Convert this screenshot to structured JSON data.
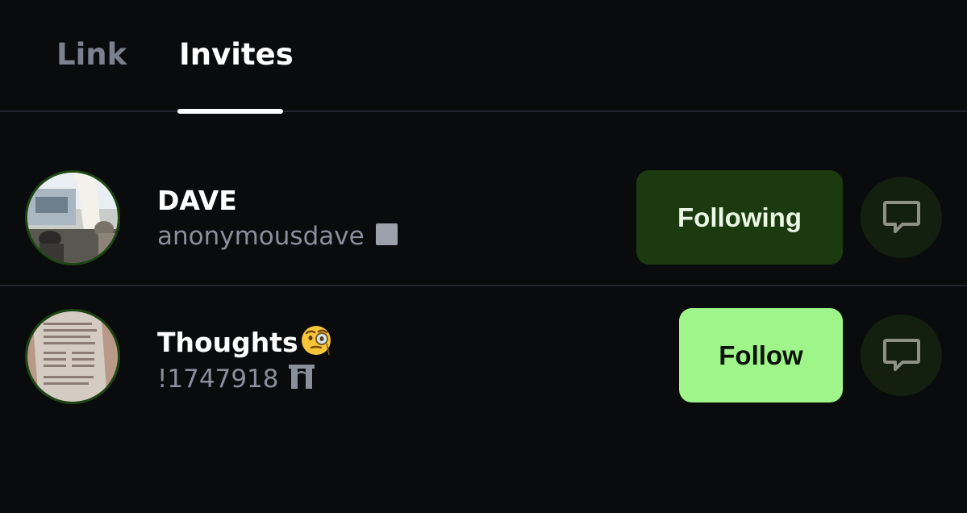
{
  "tabs": [
    {
      "label": "Link",
      "active": false
    },
    {
      "label": "Invites",
      "active": true
    }
  ],
  "users": [
    {
      "name": "DAVE",
      "handle": "anonymousdave",
      "badge_icon": "square-badge-icon",
      "action_label": "Following",
      "action_state": "following",
      "avatar_icon": "room-photo-avatar",
      "message_icon": "chat-bubble-icon"
    },
    {
      "name": "Thoughts",
      "name_emoji": "face-with-monocle",
      "handle": "!1747918",
      "badge_icon": "gate-icon",
      "action_label": "Follow",
      "action_state": "not-following",
      "avatar_icon": "book-page-avatar",
      "message_icon": "chat-bubble-icon"
    }
  ],
  "colors": {
    "background": "#0a0b0d",
    "divider": "#22252b",
    "following_bg": "#1b3a10",
    "follow_bg": "#9ff58a",
    "message_bg": "#13200f",
    "muted_text": "#8a8f9b"
  }
}
